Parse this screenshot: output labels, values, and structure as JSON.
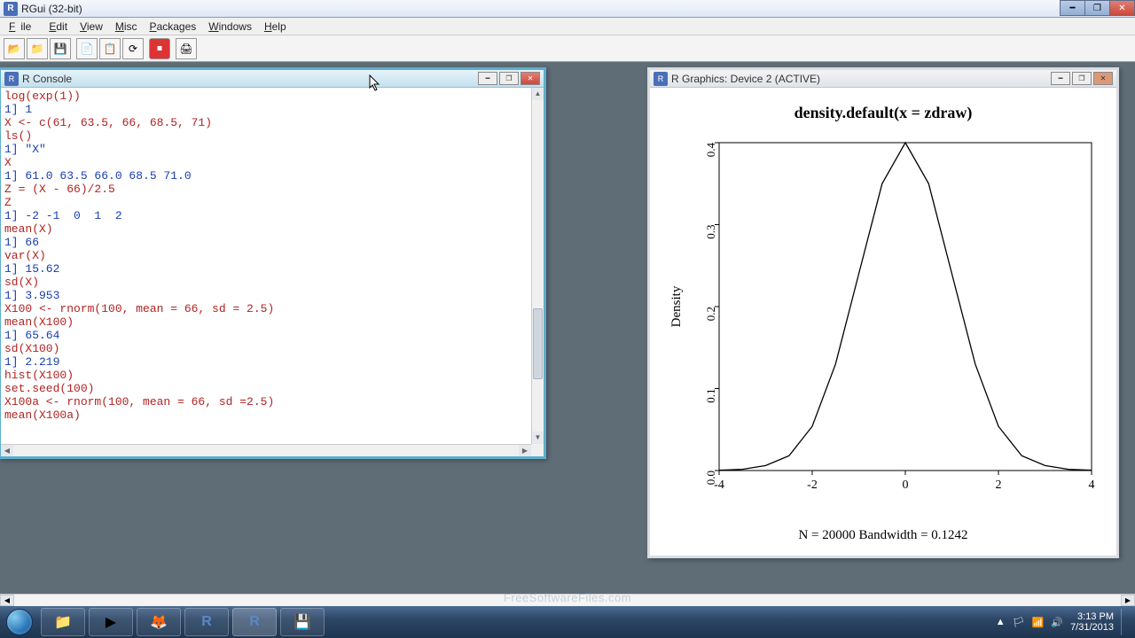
{
  "window": {
    "title": "RGui (32-bit)"
  },
  "menu": {
    "file": "File",
    "edit": "Edit",
    "view": "View",
    "misc": "Misc",
    "packages": "Packages",
    "windows": "Windows",
    "help": "Help"
  },
  "toolbar": {
    "open": "open-icon",
    "load": "load-icon",
    "save": "save-icon",
    "copy": "copy-icon",
    "paste": "paste-icon",
    "sync": "sync-icon",
    "stop": "stop-icon",
    "print": "print-icon"
  },
  "console": {
    "title": "R Console",
    "lines": [
      {
        "t": "cmd",
        "v": "log(exp(1))"
      },
      {
        "t": "out",
        "v": "1] 1"
      },
      {
        "t": "cmd",
        "v": "X <- c(61, 63.5, 66, 68.5, 71)"
      },
      {
        "t": "cmd",
        "v": "ls()"
      },
      {
        "t": "out",
        "v": "1] \"X\""
      },
      {
        "t": "cmd",
        "v": "X"
      },
      {
        "t": "out",
        "v": "1] 61.0 63.5 66.0 68.5 71.0"
      },
      {
        "t": "cmd",
        "v": "Z = (X - 66)/2.5"
      },
      {
        "t": "cmd",
        "v": "Z"
      },
      {
        "t": "out",
        "v": "1] -2 -1  0  1  2"
      },
      {
        "t": "cmd",
        "v": "mean(X)"
      },
      {
        "t": "out",
        "v": "1] 66"
      },
      {
        "t": "cmd",
        "v": "var(X)"
      },
      {
        "t": "out",
        "v": "1] 15.62"
      },
      {
        "t": "cmd",
        "v": "sd(X)"
      },
      {
        "t": "out",
        "v": "1] 3.953"
      },
      {
        "t": "cmd",
        "v": "X100 <- rnorm(100, mean = 66, sd = 2.5)"
      },
      {
        "t": "cmd",
        "v": "mean(X100)"
      },
      {
        "t": "out",
        "v": "1] 65.64"
      },
      {
        "t": "cmd",
        "v": "sd(X100)"
      },
      {
        "t": "out",
        "v": "1] 2.219"
      },
      {
        "t": "cmd",
        "v": "hist(X100)"
      },
      {
        "t": "cmd",
        "v": "set.seed(100)"
      },
      {
        "t": "cmd",
        "v": "X100a <- rnorm(100, mean = 66, sd =2.5)"
      },
      {
        "t": "cmd",
        "v": "mean(X100a)"
      }
    ]
  },
  "graphics": {
    "title": "R Graphics: Device 2 (ACTIVE)",
    "plot_title": "density.default(x = zdraw)",
    "ylabel": "Density",
    "sub": "N = 20000   Bandwidth = 0.1242"
  },
  "chart_data": {
    "type": "line",
    "title": "density.default(x = zdraw)",
    "xlabel": "",
    "ylabel": "Density",
    "subtitle": "N = 20000   Bandwidth = 0.1242",
    "xlim": [
      -4,
      4
    ],
    "ylim": [
      0,
      0.4
    ],
    "x_ticks": [
      -4,
      -2,
      0,
      2,
      4
    ],
    "y_ticks": [
      0.0,
      0.1,
      0.2,
      0.3,
      0.4
    ],
    "x": [
      -4.0,
      -3.5,
      -3.0,
      -2.5,
      -2.0,
      -1.5,
      -1.0,
      -0.5,
      0.0,
      0.5,
      1.0,
      1.5,
      2.0,
      2.5,
      3.0,
      3.5,
      4.0
    ],
    "values": [
      0.0003,
      0.0015,
      0.006,
      0.018,
      0.054,
      0.13,
      0.24,
      0.35,
      0.4,
      0.35,
      0.24,
      0.13,
      0.054,
      0.018,
      0.006,
      0.0015,
      0.0003
    ]
  },
  "taskbar": {
    "time": "3:13 PM",
    "date": "7/31/2013"
  },
  "watermark": "FreeSoftwareFiles.com"
}
